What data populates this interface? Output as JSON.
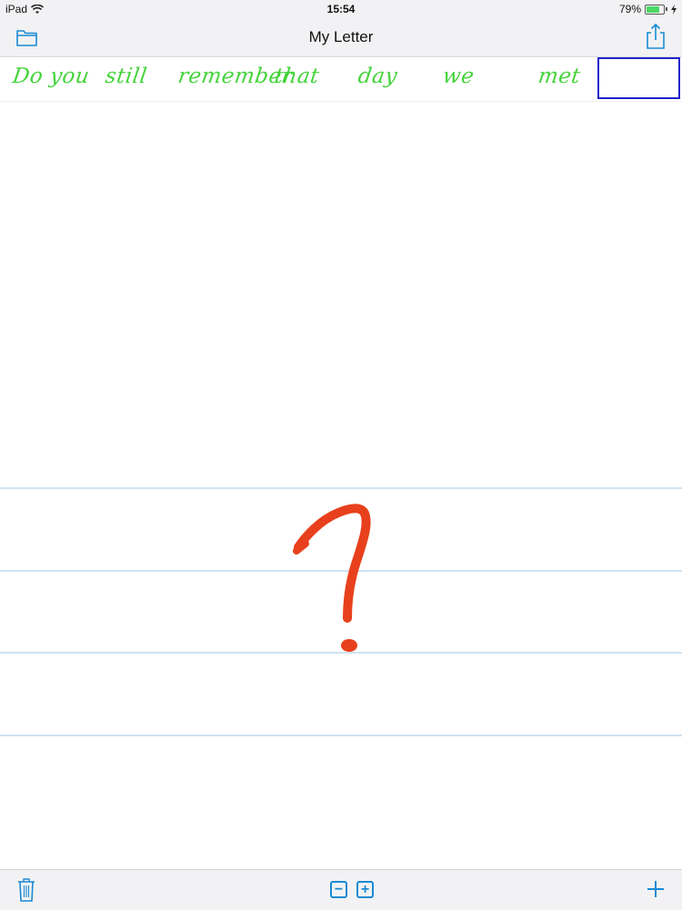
{
  "status_bar": {
    "device": "iPad",
    "time": "15:54",
    "battery": "79%",
    "battery_level": 0.79
  },
  "nav": {
    "title": "My Letter",
    "left_icon": "folder-icon",
    "right_icon": "share-icon"
  },
  "handwriting_words": [
    "Do you",
    "still",
    "remember",
    "that",
    "day",
    "we",
    "met"
  ],
  "drawing": {
    "symbol": "?",
    "color": "#e8401c"
  },
  "toolbar": {
    "left_icon": "trash-icon",
    "zoom_out_label": "−",
    "zoom_in_label": "+",
    "add_label": "+"
  },
  "colors": {
    "accent": "#1a8ad4",
    "handwriting": "#44d33a",
    "ruled_line": "#cfe3f4",
    "selection": "#2222cc"
  }
}
